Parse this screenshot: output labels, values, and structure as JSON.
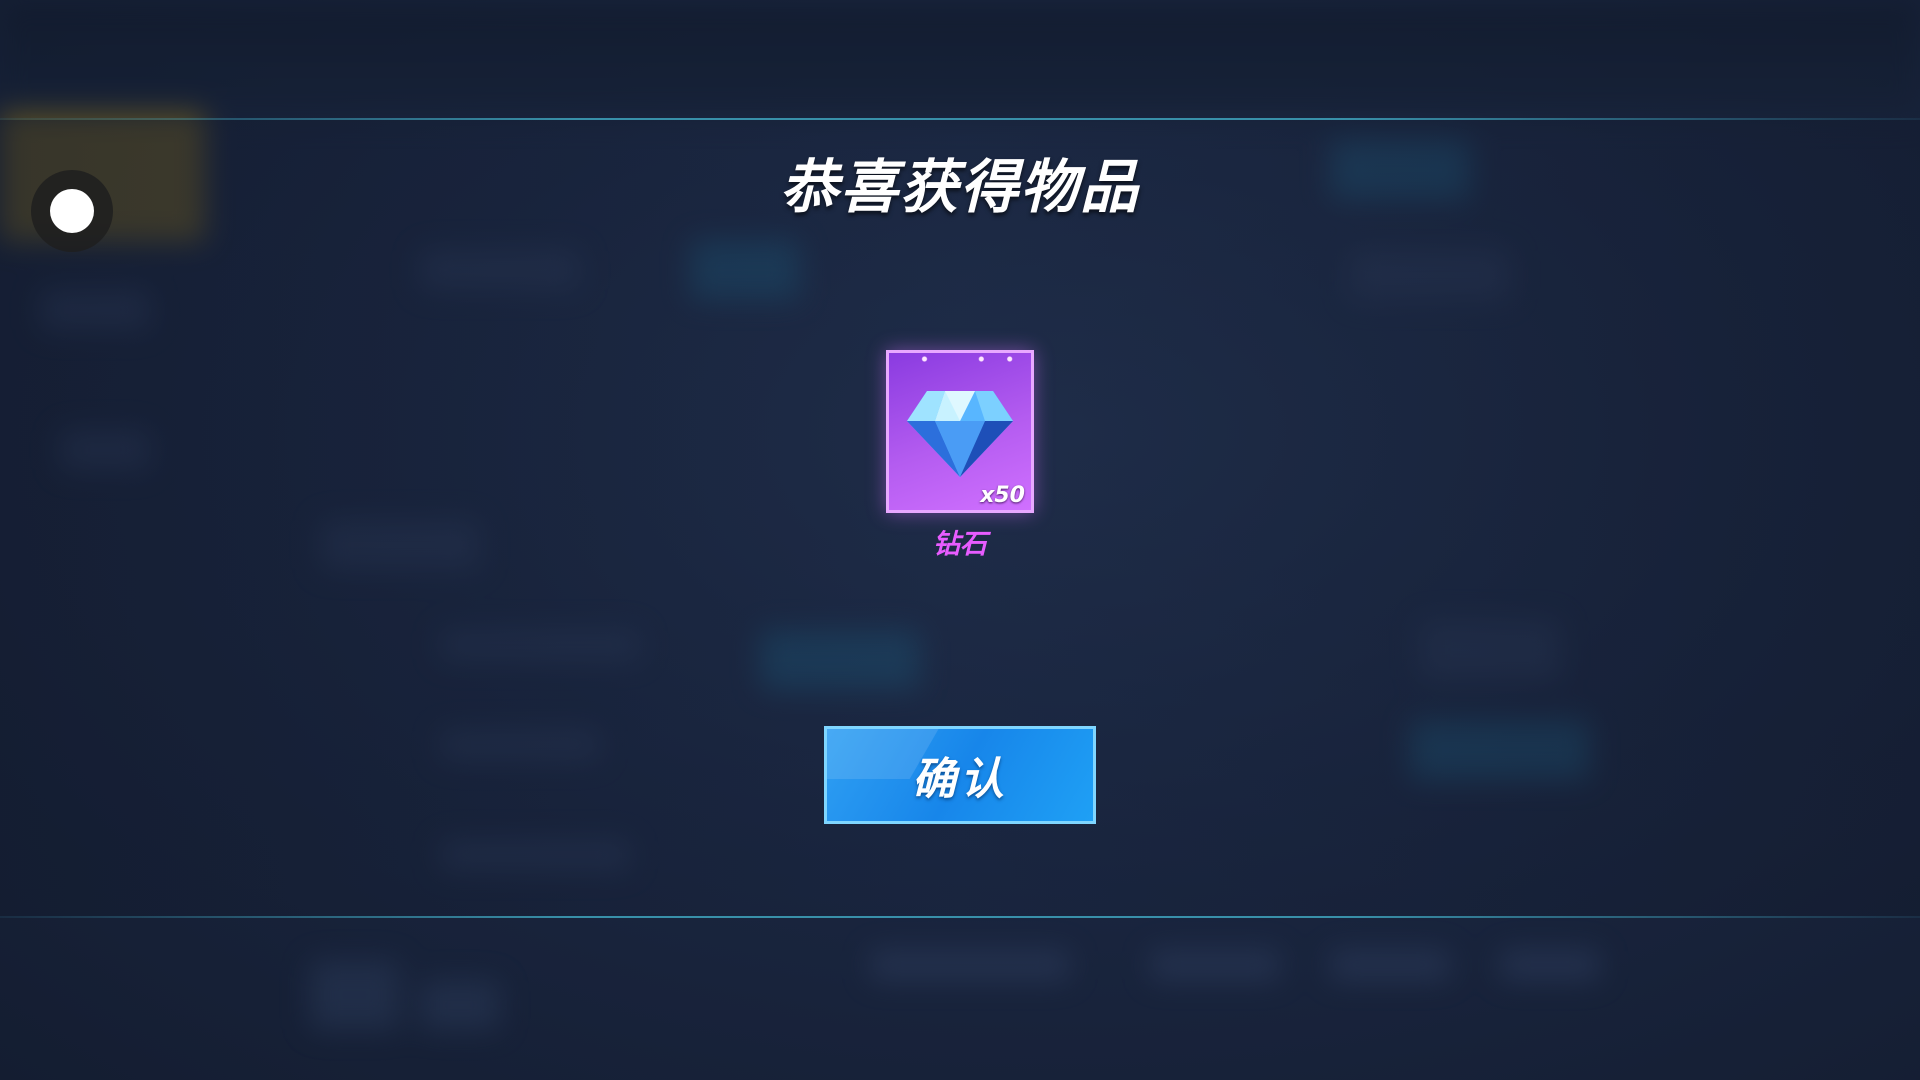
{
  "dialog": {
    "title": "恭喜获得物品",
    "reward": {
      "icon": "diamond-icon",
      "quantity": "x50",
      "name": "钻石",
      "name_color": "#e75cff",
      "card_color": "#b45cf0"
    },
    "confirm_label": "确认",
    "button_color": "#1786ea"
  },
  "recorder": {
    "icon": "record-icon"
  }
}
